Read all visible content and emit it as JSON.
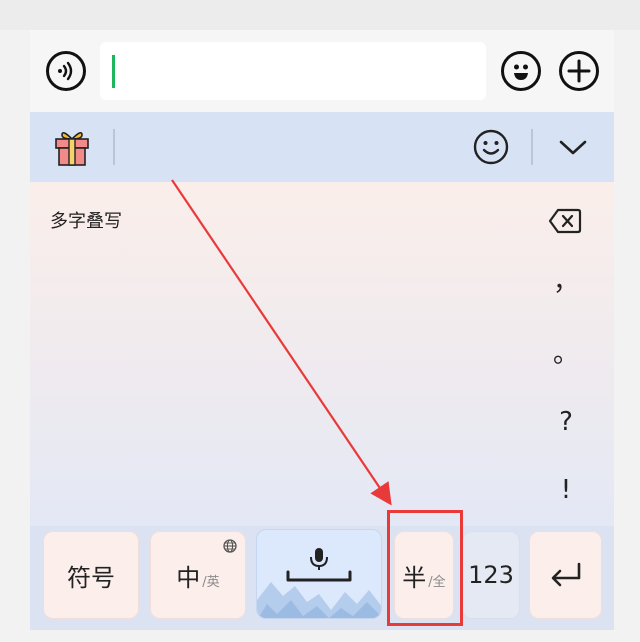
{
  "input_bar": {
    "icons": [
      "voice-icon",
      "emoji-icon",
      "plus-icon"
    ],
    "text_value": "",
    "caret_color": "#1db65a"
  },
  "toolbar": {
    "icons": [
      "gift-icon",
      "smile-icon",
      "chevron-down-icon"
    ]
  },
  "handwriting": {
    "mode_label": "多字叠写",
    "punctuation": [
      "，",
      "。",
      "?",
      "!"
    ]
  },
  "keys": {
    "symbols": "符号",
    "cn": "中",
    "en": "/英",
    "half": "半",
    "full": "/全",
    "numbers": "123"
  },
  "annotation": {
    "color": "#e93a3a"
  }
}
